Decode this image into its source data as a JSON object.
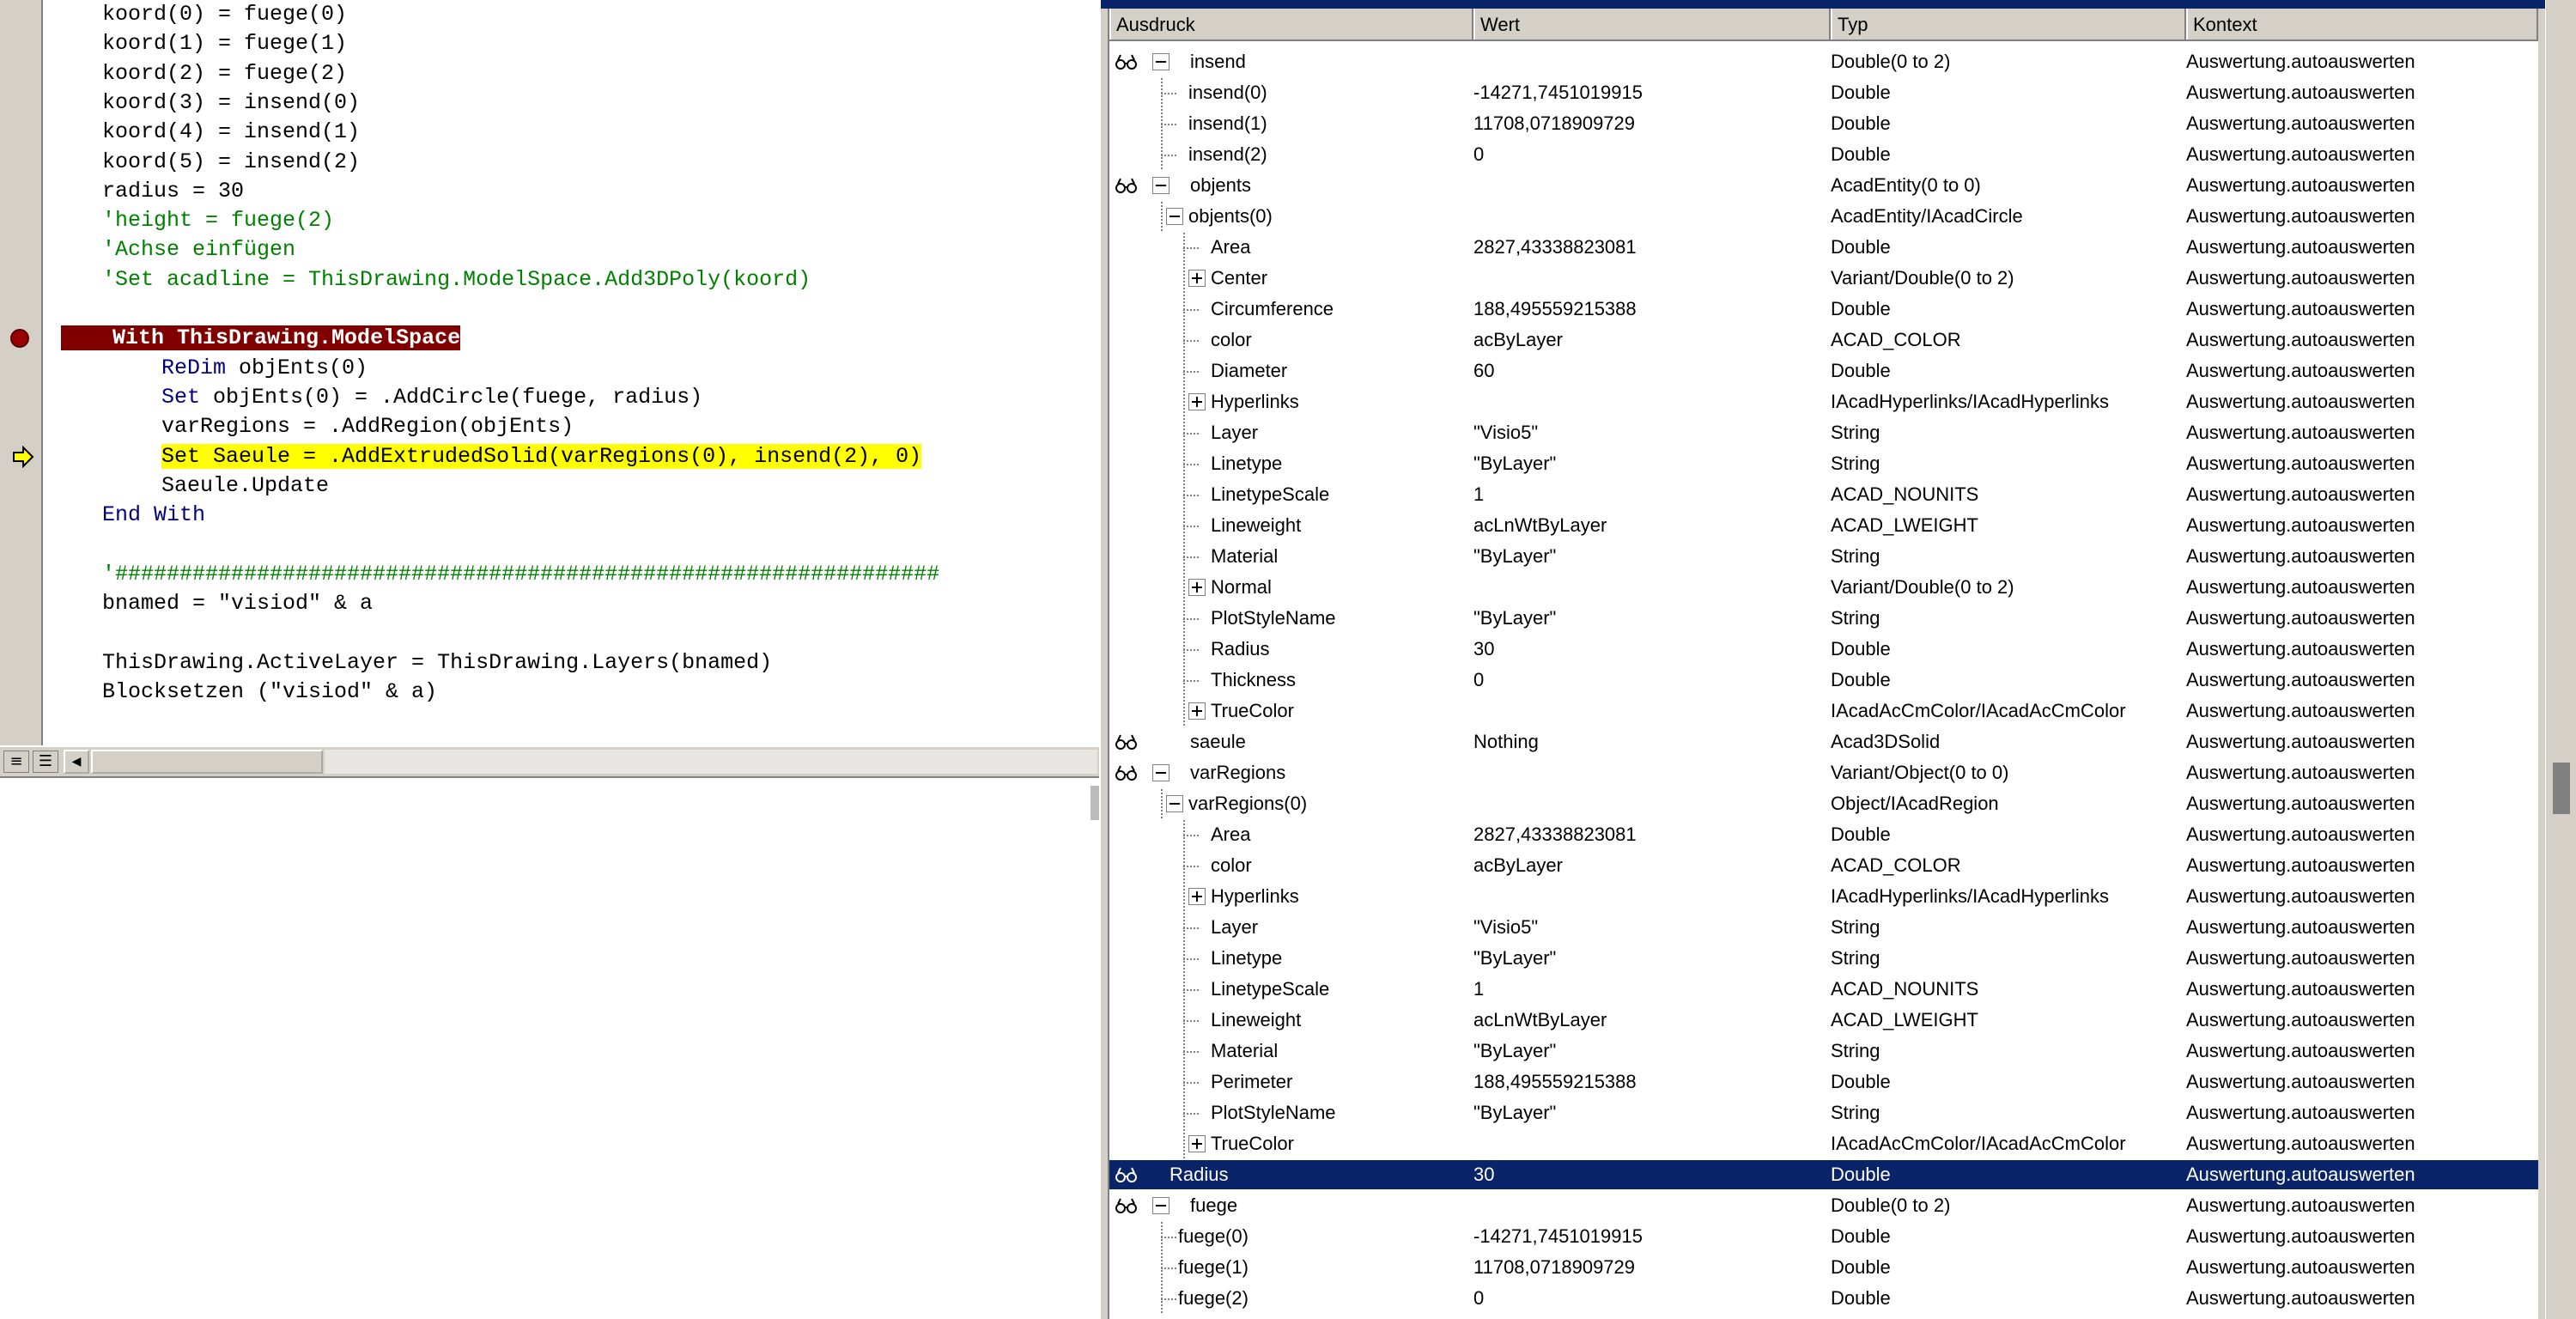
{
  "code": {
    "lines": [
      {
        "indent": 1,
        "text": "koord(0) = fuege(0)",
        "style": "plain"
      },
      {
        "indent": 1,
        "text": "koord(1) = fuege(1)",
        "style": "plain"
      },
      {
        "indent": 1,
        "text": "koord(2) = fuege(2)",
        "style": "plain"
      },
      {
        "indent": 1,
        "text": "koord(3) = insend(0)",
        "style": "plain"
      },
      {
        "indent": 1,
        "text": "koord(4) = insend(1)",
        "style": "plain"
      },
      {
        "indent": 1,
        "text": "koord(5) = insend(2)",
        "style": "plain"
      },
      {
        "indent": 1,
        "text": "radius = 30",
        "style": "plain"
      },
      {
        "indent": 1,
        "text": "'height = fuege(2)",
        "style": "comment"
      },
      {
        "indent": 1,
        "text": "'Achse einfügen",
        "style": "comment"
      },
      {
        "indent": 1,
        "text": "'Set acadline = ThisDrawing.ModelSpace.Add3DPoly(koord)",
        "style": "comment"
      },
      {
        "indent": 1,
        "text": "",
        "style": "plain"
      },
      {
        "indent": 1,
        "text": "With ThisDrawing.ModelSpace",
        "style": "breakpoint"
      },
      {
        "indent": 2,
        "kw": "ReDim",
        "text": " objEnts(0)",
        "style": "kwline"
      },
      {
        "indent": 2,
        "kw": "Set",
        "text": " objEnts(0) = .AddCircle(fuege, radius)",
        "style": "kwline"
      },
      {
        "indent": 2,
        "text": "varRegions = .AddRegion(objEnts)",
        "style": "plain"
      },
      {
        "indent": 2,
        "text": "Set Saeule = .AddExtrudedSolid(varRegions(0), insend(2), 0)",
        "style": "current"
      },
      {
        "indent": 2,
        "text": "Saeule.Update",
        "style": "plain"
      },
      {
        "indent": 1,
        "text": "End With",
        "style": "keyword"
      },
      {
        "indent": 1,
        "text": "",
        "style": "plain"
      },
      {
        "indent": 1,
        "text": "'################################################################",
        "style": "comment"
      },
      {
        "indent": 1,
        "text": "bnamed = \"visiod\" & a",
        "style": "plain"
      },
      {
        "indent": 1,
        "text": "",
        "style": "plain"
      },
      {
        "indent": 1,
        "text": "ThisDrawing.ActiveLayer = ThisDrawing.Layers(bnamed)",
        "style": "plain"
      },
      {
        "indent": 1,
        "text": "Blocksetzen (\"visiod\" & a)",
        "style": "plain"
      }
    ]
  },
  "watch": {
    "columns": [
      "Ausdruck",
      "Wert",
      "Typ",
      "Kontext"
    ],
    "rows": [
      {
        "level": 0,
        "glasses": true,
        "expander": "minus",
        "expr": "insend",
        "value": "",
        "type": "Double(0 to 2)",
        "context": "Auswertung.autoauswerten"
      },
      {
        "level": 1,
        "expr": "insend(0)",
        "value": "-14271,7451019915",
        "type": "Double",
        "context": "Auswertung.autoauswerten"
      },
      {
        "level": 1,
        "expr": "insend(1)",
        "value": "11708,0718909729",
        "type": "Double",
        "context": "Auswertung.autoauswerten"
      },
      {
        "level": 1,
        "expr": "insend(2)",
        "value": "0",
        "type": "Double",
        "context": "Auswertung.autoauswerten"
      },
      {
        "level": 0,
        "glasses": true,
        "expander": "minus",
        "expr": "objents",
        "value": "",
        "type": "AcadEntity(0 to 0)",
        "context": "Auswertung.autoauswerten"
      },
      {
        "level": 1,
        "expander": "minus",
        "expr": "objents(0)",
        "value": "",
        "type": "AcadEntity/IAcadCircle",
        "context": "Auswertung.autoauswerten"
      },
      {
        "level": 2,
        "expr": "Area",
        "value": "2827,43338823081",
        "type": "Double",
        "context": "Auswertung.autoauswerten"
      },
      {
        "level": 2,
        "expander": "plus",
        "expr": "Center",
        "value": "",
        "type": "Variant/Double(0 to 2)",
        "context": "Auswertung.autoauswerten"
      },
      {
        "level": 2,
        "expr": "Circumference",
        "value": "188,495559215388",
        "type": "Double",
        "context": "Auswertung.autoauswerten"
      },
      {
        "level": 2,
        "expr": "color",
        "value": "acByLayer",
        "type": "ACAD_COLOR",
        "context": "Auswertung.autoauswerten"
      },
      {
        "level": 2,
        "expr": "Diameter",
        "value": "60",
        "type": "Double",
        "context": "Auswertung.autoauswerten"
      },
      {
        "level": 2,
        "expander": "plus",
        "expr": "Hyperlinks",
        "value": "",
        "type": "IAcadHyperlinks/IAcadHyperlinks",
        "context": "Auswertung.autoauswerten"
      },
      {
        "level": 2,
        "expr": "Layer",
        "value": "\"Visio5\"",
        "type": "String",
        "context": "Auswertung.autoauswerten"
      },
      {
        "level": 2,
        "expr": "Linetype",
        "value": "\"ByLayer\"",
        "type": "String",
        "context": "Auswertung.autoauswerten"
      },
      {
        "level": 2,
        "expr": "LinetypeScale",
        "value": "1",
        "type": "ACAD_NOUNITS",
        "context": "Auswertung.autoauswerten"
      },
      {
        "level": 2,
        "expr": "Lineweight",
        "value": "acLnWtByLayer",
        "type": "ACAD_LWEIGHT",
        "context": "Auswertung.autoauswerten"
      },
      {
        "level": 2,
        "expr": "Material",
        "value": "\"ByLayer\"",
        "type": "String",
        "context": "Auswertung.autoauswerten"
      },
      {
        "level": 2,
        "expander": "plus",
        "expr": "Normal",
        "value": "",
        "type": "Variant/Double(0 to 2)",
        "context": "Auswertung.autoauswerten"
      },
      {
        "level": 2,
        "expr": "PlotStyleName",
        "value": "\"ByLayer\"",
        "type": "String",
        "context": "Auswertung.autoauswerten"
      },
      {
        "level": 2,
        "expr": "Radius",
        "value": "30",
        "type": "Double",
        "context": "Auswertung.autoauswerten"
      },
      {
        "level": 2,
        "expr": "Thickness",
        "value": "0",
        "type": "Double",
        "context": "Auswertung.autoauswerten"
      },
      {
        "level": 2,
        "expander": "plus",
        "expr": "TrueColor",
        "value": "",
        "type": "IAcadAcCmColor/IAcadAcCmColor",
        "context": "Auswertung.autoauswerten"
      },
      {
        "level": 0,
        "glasses": true,
        "expr": "saeule",
        "value": "Nothing",
        "type": "Acad3DSolid",
        "context": "Auswertung.autoauswerten"
      },
      {
        "level": 0,
        "glasses": true,
        "expander": "minus",
        "expr": "varRegions",
        "value": "",
        "type": "Variant/Object(0 to 0)",
        "context": "Auswertung.autoauswerten"
      },
      {
        "level": 1,
        "expander": "minus",
        "expr": "varRegions(0)",
        "value": "",
        "type": "Object/IAcadRegion",
        "context": "Auswertung.autoauswerten"
      },
      {
        "level": 2,
        "expr": "Area",
        "value": "2827,43338823081",
        "type": "Double",
        "context": "Auswertung.autoauswerten"
      },
      {
        "level": 2,
        "expr": "color",
        "value": "acByLayer",
        "type": "ACAD_COLOR",
        "context": "Auswertung.autoauswerten"
      },
      {
        "level": 2,
        "expander": "plus",
        "expr": "Hyperlinks",
        "value": "",
        "type": "IAcadHyperlinks/IAcadHyperlinks",
        "context": "Auswertung.autoauswerten"
      },
      {
        "level": 2,
        "expr": "Layer",
        "value": "\"Visio5\"",
        "type": "String",
        "context": "Auswertung.autoauswerten"
      },
      {
        "level": 2,
        "expr": "Linetype",
        "value": "\"ByLayer\"",
        "type": "String",
        "context": "Auswertung.autoauswerten"
      },
      {
        "level": 2,
        "expr": "LinetypeScale",
        "value": "1",
        "type": "ACAD_NOUNITS",
        "context": "Auswertung.autoauswerten"
      },
      {
        "level": 2,
        "expr": "Lineweight",
        "value": "acLnWtByLayer",
        "type": "ACAD_LWEIGHT",
        "context": "Auswertung.autoauswerten"
      },
      {
        "level": 2,
        "expr": "Material",
        "value": "\"ByLayer\"",
        "type": "String",
        "context": "Auswertung.autoauswerten"
      },
      {
        "level": 2,
        "expr": "Perimeter",
        "value": "188,495559215388",
        "type": "Double",
        "context": "Auswertung.autoauswerten"
      },
      {
        "level": 2,
        "expr": "PlotStyleName",
        "value": "\"ByLayer\"",
        "type": "String",
        "context": "Auswertung.autoauswerten"
      },
      {
        "level": 2,
        "expander": "plus",
        "expr": "TrueColor",
        "value": "",
        "type": "IAcadAcCmColor/IAcadAcCmColor",
        "context": "Auswertung.autoauswerten"
      },
      {
        "level": 0,
        "glasses": true,
        "selected": true,
        "expr": "Radius",
        "value": "30",
        "type": "Double",
        "context": "Auswertung.autoauswerten"
      },
      {
        "level": 0,
        "glasses": true,
        "expander": "minus",
        "expr": "fuege",
        "value": "",
        "type": "Double(0 to 2)",
        "context": "Auswertung.autoauswerten"
      },
      {
        "level": 1,
        "expr": "fuege(0)",
        "value": "-14271,7451019915",
        "type": "Double",
        "context": "Auswertung.autoauswerten"
      },
      {
        "level": 1,
        "expr": "fuege(1)",
        "value": "11708,0718909729",
        "type": "Double",
        "context": "Auswertung.autoauswerten"
      },
      {
        "level": 1,
        "expr": "fuege(2)",
        "value": "0",
        "type": "Double",
        "context": "Auswertung.autoauswerten"
      }
    ]
  },
  "colors": {
    "breakpoint_bg": "#800000",
    "current_line_bg": "#ffff00",
    "keyword": "#00007f",
    "comment": "#008000",
    "selection": "#0a246a",
    "chrome": "#d4d0c8"
  }
}
